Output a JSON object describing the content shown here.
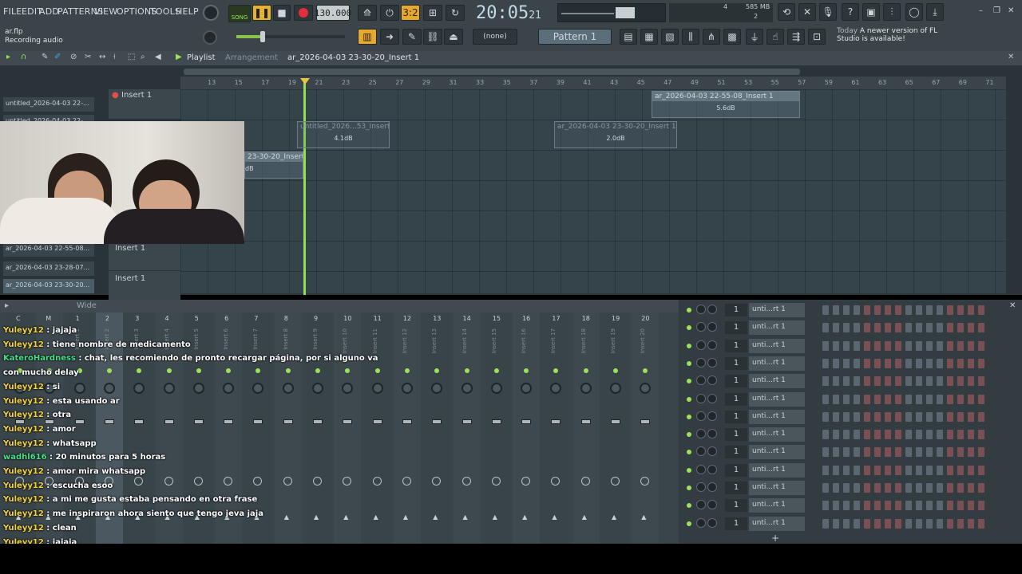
{
  "menu": [
    "FILE",
    "EDIT",
    "ADD",
    "PATTERNS",
    "VIEW",
    "OPTIONS",
    "TOOLS",
    "HELP"
  ],
  "transport": {
    "mode": "SONG",
    "tempo": "130.000",
    "time": "20:05",
    "time_small": "21",
    "pattern": "Pattern 1",
    "none_select": "(none)"
  },
  "hint": {
    "file": "ar.flp",
    "status": "Recording audio"
  },
  "cpu": {
    "mem": "585 MB",
    "voices": "4",
    "poly": "2"
  },
  "update_notice": {
    "when": "Today",
    "text": "A newer version of FL Studio is available!"
  },
  "playlist": {
    "title": "Playlist",
    "subtitle": "Arrangement",
    "breadcrumb": "ar_2026-04-03 23-30-20_Insert 1",
    "ruler": [
      "13",
      "15",
      "17",
      "19",
      "21",
      "23",
      "25",
      "27",
      "29",
      "31",
      "33",
      "35",
      "37",
      "39",
      "41",
      "43",
      "45",
      "47",
      "49",
      "51",
      "53",
      "55",
      "57",
      "59",
      "61",
      "63",
      "65",
      "67",
      "69",
      "71"
    ],
    "browser": [
      "untitled_2026-04-03 22-...",
      "untitled_2026-04-03 22-...",
      "ar_2026-04-03 22-55-08...",
      "ar_2026-04-03 23-28-07...",
      "ar_2026-04-03 23-30-20..."
    ],
    "tracks": [
      "Insert 1",
      "",
      "",
      "",
      "",
      "Insert 1",
      "Insert 1"
    ],
    "clips": [
      {
        "title": "ar_2026-04-03 22-55-08_Insert 1",
        "label": "5.6dB"
      },
      {
        "title": "untitled_2026...53_Insert 1",
        "label": "4.1dB"
      },
      {
        "title": "ar_2026-04-03 23-30-20_Insert 1",
        "label": "2.0dB"
      },
      {
        "title": "23-30-20_Insert 1",
        "label": "dB"
      }
    ]
  },
  "mixer": {
    "header": "Wide",
    "numbers": [
      "C",
      "M",
      "1",
      "2",
      "3",
      "4",
      "5",
      "6",
      "7",
      "8",
      "9",
      "10",
      "11",
      "12",
      "13",
      "14",
      "15",
      "16",
      "17",
      "18",
      "19",
      "20"
    ],
    "inserts": [
      "Insert 1",
      "Insert 2",
      "Insert 3",
      "Insert 4",
      "Insert 5",
      "Insert 6",
      "Insert 7",
      "Insert 8",
      "Insert 9",
      "Insert 10",
      "Insert 11",
      "Insert 12",
      "Insert 13",
      "Insert 14",
      "Insert 15",
      "Insert 16",
      "Insert 17",
      "Insert 18",
      "Insert 19",
      "Insert 20"
    ]
  },
  "channel_rack": {
    "rows": [
      "unti...rt 1",
      "unti...rt 1",
      "unti...rt 1",
      "unti...rt 1",
      "unti...rt 1",
      "unti...rt 1",
      "unti...rt 1",
      "unti...rt 1",
      "unti...rt 1",
      "unti...rt 1",
      "unti...rt 1",
      "unti...rt 1",
      "unti...rt 1"
    ],
    "channel_num": "1"
  },
  "chat": [
    {
      "user": "Yuleyy12",
      "msg": "jajaja",
      "kind": "a"
    },
    {
      "user": "Yuleyy12",
      "msg": "tiene nombre de medicamento",
      "kind": "a"
    },
    {
      "user": "KateroHardness",
      "msg": "chat, les recomiendo de pronto recargar página, por si alguno va",
      "kind": "b"
    },
    {
      "user": "",
      "msg": "con mucho delay",
      "kind": "b"
    },
    {
      "user": "Yuleyy12",
      "msg": "si",
      "kind": "a"
    },
    {
      "user": "Yuleyy12",
      "msg": "esta usando ar",
      "kind": "a"
    },
    {
      "user": "Yuleyy12",
      "msg": "otra",
      "kind": "a"
    },
    {
      "user": "Yuleyy12",
      "msg": "amor",
      "kind": "a"
    },
    {
      "user": "Yuleyy12",
      "msg": "whatsapp",
      "kind": "a"
    },
    {
      "user": "wadhl616",
      "msg": "20 minutos para 5 horas",
      "kind": "b"
    },
    {
      "user": "Yuleyy12",
      "msg": "amor mira whatsapp",
      "kind": "a"
    },
    {
      "user": "Yuleyy12",
      "msg": "escucha esoo",
      "kind": "a"
    },
    {
      "user": "Yuleyy12",
      "msg": "a mi me gusta estaba pensando en otra frase",
      "kind": "a"
    },
    {
      "user": "Yuleyy12",
      "msg": "me inspiraron ahora siento que tengo jeva jaja",
      "kind": "a"
    },
    {
      "user": "Yuleyy12",
      "msg": "clean",
      "kind": "a"
    },
    {
      "user": "Yuleyy12",
      "msg": "jajaja",
      "kind": "a"
    }
  ],
  "colors": {
    "accent": "#9be15a",
    "record": "#e0303a",
    "chat_user": "#f5d442",
    "chat_user_alt": "#45e08b"
  }
}
